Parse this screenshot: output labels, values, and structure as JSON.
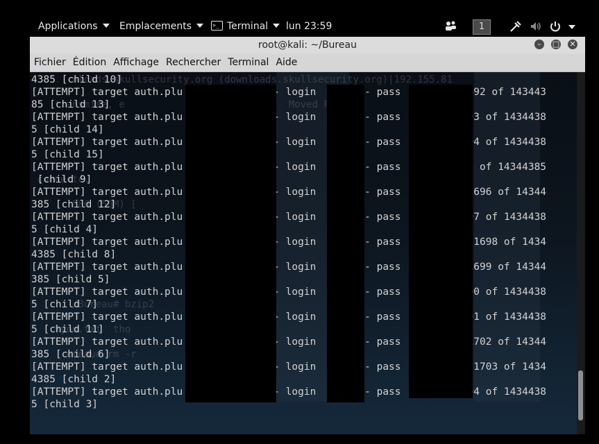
{
  "topbar": {
    "applications": "Applications",
    "places": "Emplacements",
    "terminal": "Terminal",
    "clock": "lun 23:59",
    "workspace": "1"
  },
  "window": {
    "title": "root@kali: ~/Bureau",
    "menu": [
      "Fichier",
      "Édition",
      "Affichage",
      "Rechercher",
      "Terminal",
      "Aide"
    ]
  },
  "terminal": {
    "lines": [
      "4385 [child 10]",
      "[ATTEMPT] target auth.plu               - login        - pass        - 1692 of 143443",
      "85 [child 13]",
      "[ATTEMPT] target auth.plu               - login        - pass         1693 of 1434438",
      "5 [child 14]",
      "[ATTEMPT] target auth.plu               - login        - pass         1694 of 1434438",
      "5 [child 15]",
      "[ATTEMPT] target auth.plu               - login        - pass        1695 of 14344385",
      " [child 9]",
      "[ATTEMPT] target auth.plu               - login        - pass         - 1696 of 14344",
      "385 [child 12]",
      "[ATTEMPT] target auth.plu               - login        - pass         1697 of 1434438",
      "5 [child 4]",
      "[ATTEMPT] target auth.plu               - login        - pass        \" - 1698 of 1434",
      "4385 [child 8]",
      "[ATTEMPT] target auth.plu               - login        - pass         - 1699 of 14344",
      "385 [child 5]",
      "[ATTEMPT] target auth.plu               - login        - pass         1700 of 1434438",
      "5 [child 7]",
      "[ATTEMPT] target auth.plu               - login        - pass         1701 of 1434438",
      "5 [child 11]",
      "[ATTEMPT] target auth.plu               - login        - pass         - 1702 of 14344",
      "385 [child 6]",
      "[ATTEMPT] target auth.plu               - login        - pass        \" - 1703 of 1434",
      "4385 [child 2]",
      "[ATTEMPT] target auth.plu               - login        - pass         1704 of 1434438",
      "5 [child 3]"
    ],
    "background_ghost": [
      "    .  nloads.skullsecurity.org (downloads.skullsecurity.org)|192.155.81",
      "",
      "    transmise, e              a réponse     Moved P",
      "",
      "",
      "",
      "",
      "",
      " connecté.",
      "",
      "       886 (58M) [             tet-strea",
      "",
      "",
      "",
      "",
      "",
      "",
      "",
      "       /Bureau# bzip2         t.bz2",
      "",
      "    kyou.txt  tho",
      "",
      "      ureau# rm -r         ]"
    ]
  },
  "colors": {
    "terminal_text": "#d2d2d2",
    "titlebar": "#dcdcdc",
    "menubar": "#d6d6d6"
  }
}
